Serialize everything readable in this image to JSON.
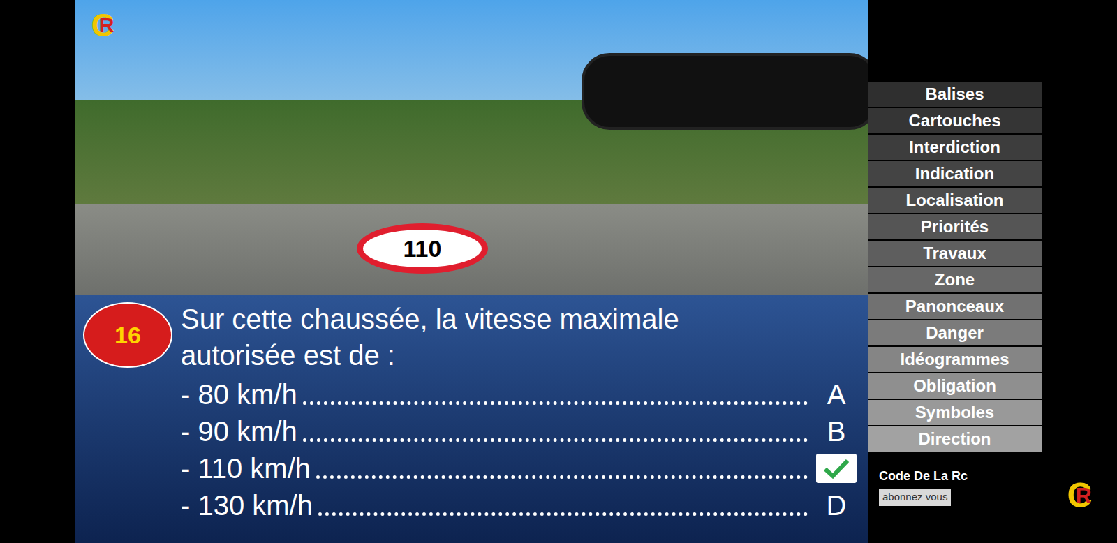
{
  "logo": {
    "c": "C",
    "r": "R"
  },
  "video": {
    "sign": "110"
  },
  "question": {
    "number": "16",
    "text": "Sur cette chaussée, la vitesse maximale autorisée est de :"
  },
  "answers": [
    {
      "label": "- 80 km/h",
      "letter": "A",
      "selected": false
    },
    {
      "label": "- 90 km/h",
      "letter": "B",
      "selected": false
    },
    {
      "label": "- 110 km/h",
      "letter": "",
      "selected": true
    },
    {
      "label": "- 130 km/h",
      "letter": "D",
      "selected": false
    }
  ],
  "categories": [
    "Balises",
    "Cartouches",
    "Interdiction",
    "Indication",
    "Localisation",
    "Priorités",
    "Travaux",
    "Zone",
    "Panonceaux",
    "Danger",
    "Idéogrammes",
    "Obligation",
    "Symboles",
    "Direction"
  ],
  "channel": {
    "name": "Code De La Rc",
    "subscribe": "abonnez vous"
  }
}
